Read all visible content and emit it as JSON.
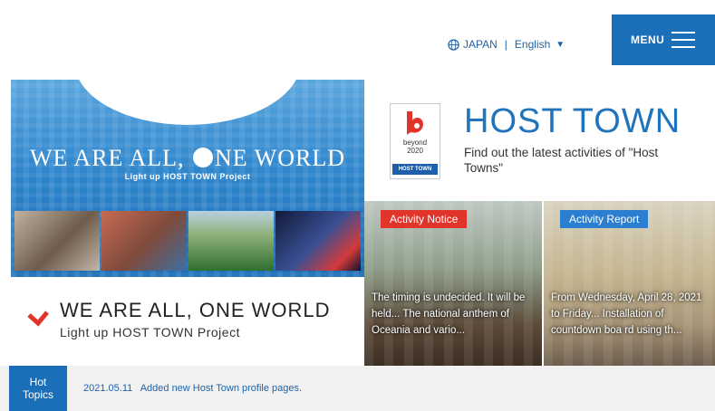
{
  "header": {
    "region_label": "JAPAN",
    "language_label": "English",
    "menu_label": "MENU"
  },
  "hero": {
    "title_part1": "WE ARE ALL,",
    "title_part2": "NE WORLD",
    "subtitle": "Light up HOST TOWN Project"
  },
  "tagline": {
    "title": "WE ARE ALL, ONE WORLD",
    "subtitle": "Light up HOST TOWN Project"
  },
  "host_town": {
    "logo_line1": "beyond",
    "logo_line2": "2020",
    "logo_band": "HOST TOWN",
    "title": "HOST TOWN",
    "description": "Find out the latest activities of \"Host Towns\""
  },
  "cards": [
    {
      "badge": "Activity Notice",
      "text": "The timing is undecided. It will be held... The national anthem of Oceania and vario..."
    },
    {
      "badge": "Activity Report",
      "text": "From Wednesday, April 28, 2021 to Friday... Installation of countdown boa rd using th..."
    }
  ],
  "hot_topics": {
    "label_line1": "Hot",
    "label_line2": "Topics",
    "items": [
      {
        "date": "2021.05.11",
        "text": "Added new Host Town profile pages."
      }
    ]
  },
  "colors": {
    "brand_blue": "#1b6fb8",
    "title_blue": "#1f74bd",
    "notice_red": "#e1352b",
    "report_blue": "#2c7ed0",
    "chevron_red": "#e1352b"
  },
  "icons": [
    "globe-icon",
    "caret-down-icon",
    "hamburger-icon",
    "chevron-down-icon",
    "beyond-2020-logo"
  ]
}
